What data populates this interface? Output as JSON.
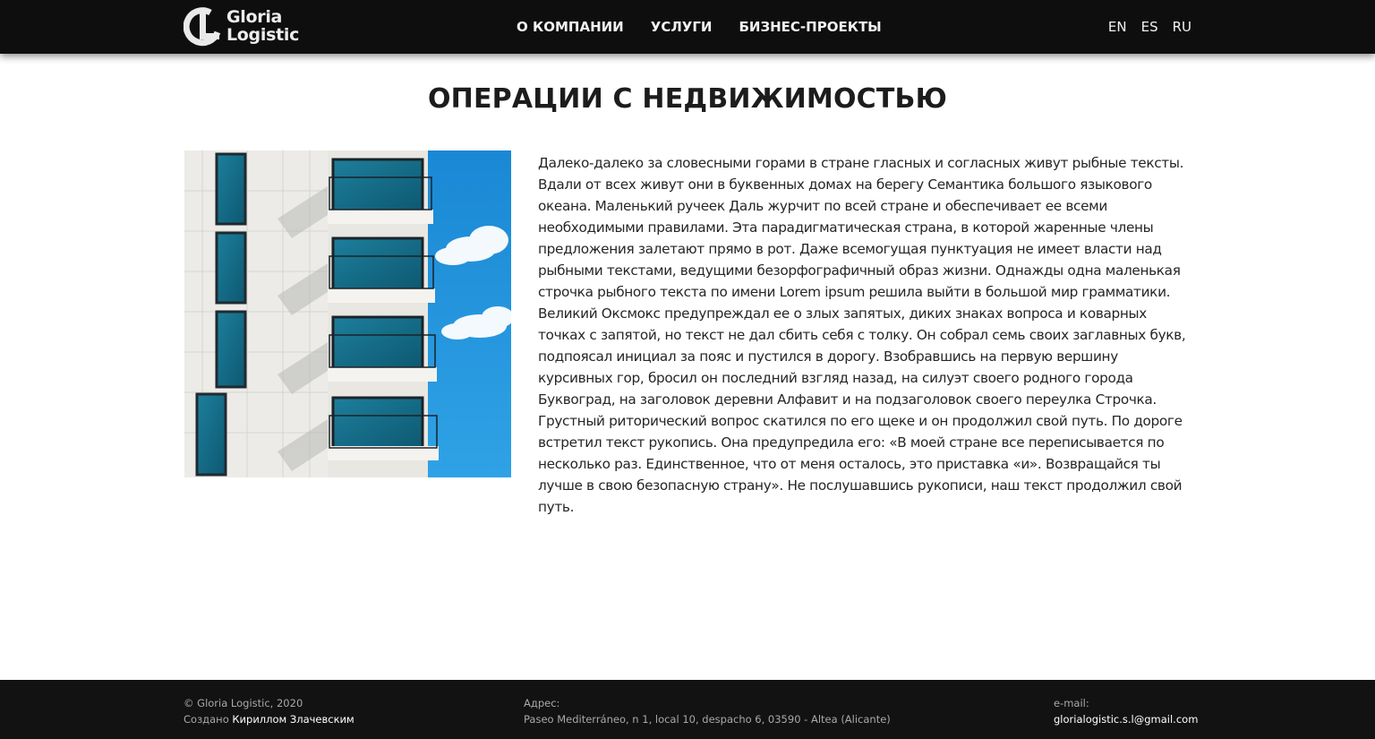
{
  "header": {
    "logo": {
      "line1": "Gloria",
      "line2": "Logistic"
    },
    "nav": [
      {
        "label": "О КОМПАНИИ"
      },
      {
        "label": "УСЛУГИ"
      },
      {
        "label": "БИЗНЕС-ПРОЕКТЫ"
      }
    ],
    "languages": [
      {
        "label": "EN"
      },
      {
        "label": "ES"
      },
      {
        "label": "RU"
      }
    ]
  },
  "main": {
    "title": "ОПЕРАЦИИ С НЕДВИЖИМОСТЬЮ",
    "image_icon": "building-balconies-photo",
    "body": "Далеко-далеко за словесными горами в стране гласных и согласных живут рыбные тексты. Вдали от всех живут они в буквенных домах на берегу Семантика большого языкового океана. Маленький ручеек Даль журчит по всей стране и обеспечивает ее всеми необходимыми правилами. Эта парадигматическая страна, в которой жаренные члены предложения залетают прямо в рот. Даже всемогущая пунктуация не имеет власти над рыбными текстами, ведущими безорфографичный образ жизни. Однажды одна маленькая строчка рыбного текста по имени Lorem ipsum решила выйти в большой мир грамматики. Великий Оксмокс предупреждал ее о злых запятых, диких знаках вопроса и коварных точках с запятой, но текст не дал сбить себя с толку. Он собрал семь своих заглавных букв, подпоясал инициал за пояс и пустился в дорогу. Взобравшись на первую вершину курсивных гор, бросил он последний взгляд назад, на силуэт своего родного города Буквоград, на заголовок деревни Алфавит и на подзаголовок своего переулка Строчка. Грустный риторический вопрос скатился по его щеке и он продолжил свой путь. По дороге встретил текст рукопись. Она предупредила его: «В моей стране все переписывается по несколько раз. Единственное, что от меня осталось, это приставка «и». Возвращайся ты лучше в свою безопасную страну». Не послушавшись рукописи, наш текст продолжил свой путь."
  },
  "footer": {
    "copyright": "© Gloria Logistic, 2020",
    "created_prefix": "Создано ",
    "created_by": "Кириллом Злачевским",
    "address_label": "Адрес:",
    "address": "Paseo Mediterráneo, n 1, local 10, despacho 6, 03590 - Altea (Alicante)",
    "email_label": "e-mail:",
    "email": "glorialogistic.s.l@gmail.com"
  },
  "colors": {
    "header_bg": "#0e0e0e",
    "footer_bg": "#121212",
    "sky": "#1f8fd6",
    "wall": "#ecebe7"
  }
}
